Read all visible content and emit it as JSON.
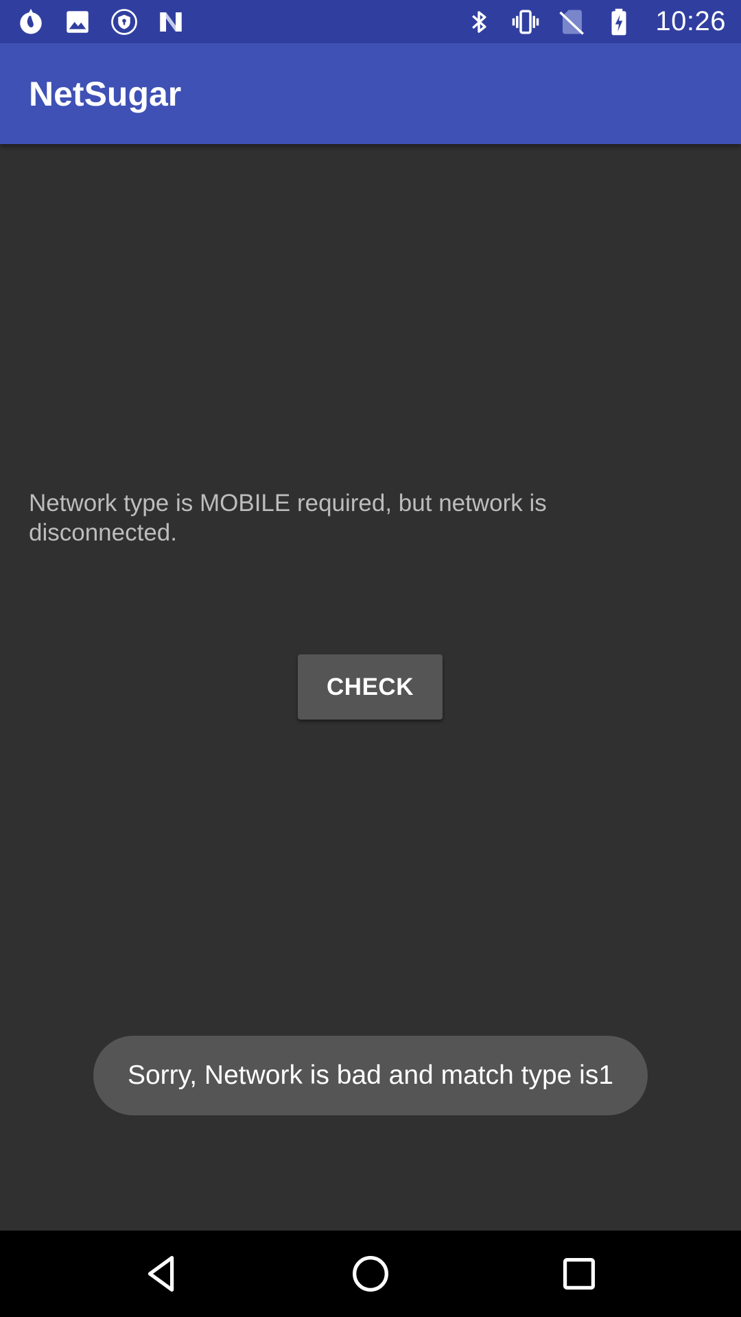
{
  "status_bar": {
    "time": "10:26",
    "left_icons": [
      "drop-notification-icon",
      "image-notification-icon",
      "shield-notification-icon",
      "n-notification-icon"
    ],
    "right_icons": [
      "bluetooth-icon",
      "vibrate-icon",
      "no-sim-icon",
      "battery-charging-icon"
    ]
  },
  "app_bar": {
    "title": "NetSugar"
  },
  "main": {
    "message": "Network type is MOBILE required, but network is disconnected.",
    "check_label": "CHECK"
  },
  "toast": {
    "text": "Sorry, Network is bad and match type is1"
  },
  "nav_bar": {
    "icons": [
      "back-icon",
      "home-icon",
      "recents-icon"
    ]
  },
  "colors": {
    "status_bar": "#303F9F",
    "app_bar": "#3F51B5",
    "background": "#303030",
    "button": "#555555",
    "toast": "#555555",
    "nav_bar": "#000000"
  }
}
